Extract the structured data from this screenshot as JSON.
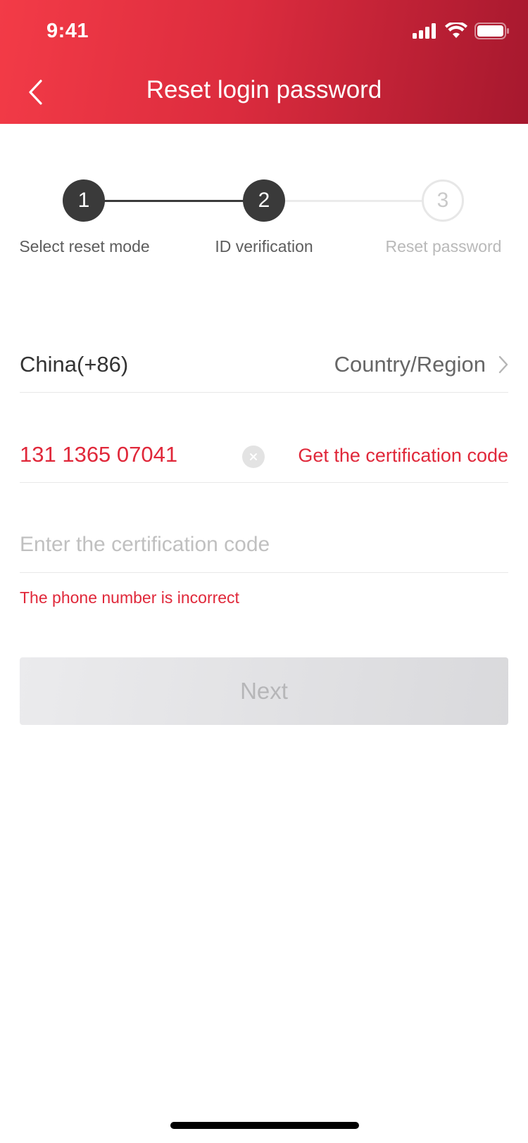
{
  "status_bar": {
    "time": "9:41"
  },
  "nav": {
    "title": "Reset login password",
    "back_icon": "chevron-left-icon"
  },
  "steps": [
    {
      "number": "1",
      "label": "Select reset mode",
      "state": "done"
    },
    {
      "number": "2",
      "label": "ID verification",
      "state": "current"
    },
    {
      "number": "3",
      "label": "Reset password",
      "state": "todo"
    }
  ],
  "country": {
    "value": "China(+86)",
    "link_label": "Country/Region"
  },
  "phone": {
    "value": "131 1365 07041",
    "get_code_label": "Get the certification code"
  },
  "code": {
    "placeholder": "Enter the certification code"
  },
  "error": {
    "message": "The phone number is incorrect"
  },
  "next_button": {
    "label": "Next",
    "enabled": false
  },
  "colors": {
    "header_start": "#f33b47",
    "header_end": "#a6182e",
    "accent": "#e0283a",
    "step_active": "#3a3a3a"
  }
}
